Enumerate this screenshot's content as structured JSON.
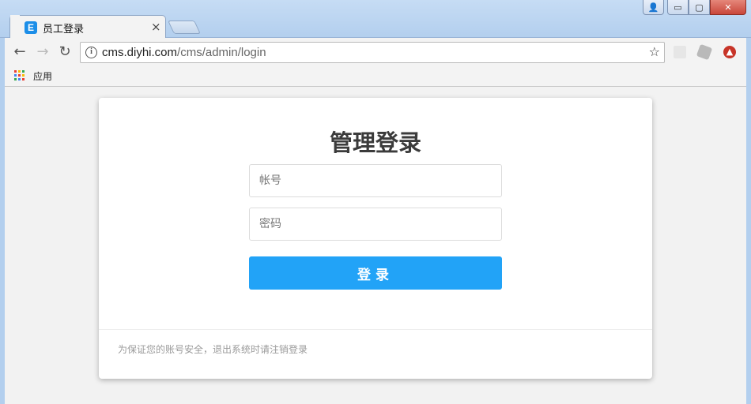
{
  "browser": {
    "tab": {
      "favicon_text": "E",
      "title": "员工登录",
      "close_glyph": "×"
    },
    "window_controls": {
      "user_glyph": "👤",
      "minimize_glyph": "▭",
      "maximize_glyph": "▢",
      "close_glyph": "✕"
    },
    "nav": {
      "back_glyph": "←",
      "forward_glyph": "→",
      "reload_glyph": "↻"
    },
    "address": {
      "info_glyph": "i",
      "host": "cms.diyhi.com",
      "path": "/cms/admin/login",
      "bookmark_glyph": "☆"
    },
    "extensions": {
      "ext3_glyph": "▲"
    },
    "bookmarks_bar": {
      "apps_label": "应用"
    }
  },
  "login_card": {
    "title": "管理登录",
    "account_placeholder": "帐号",
    "password_placeholder": "密码",
    "submit_label": "登录",
    "security_note": "为保证您的账号安全，退出系统时请注销登录"
  },
  "colors": {
    "accent": "#22a3f7",
    "title_text": "#3b3b3b",
    "page_background": "#f2f2f2"
  },
  "icons": {
    "favicon": "app-favicon-icon",
    "apps": "apps-grid-icon",
    "info": "info-icon",
    "star": "star-icon"
  }
}
